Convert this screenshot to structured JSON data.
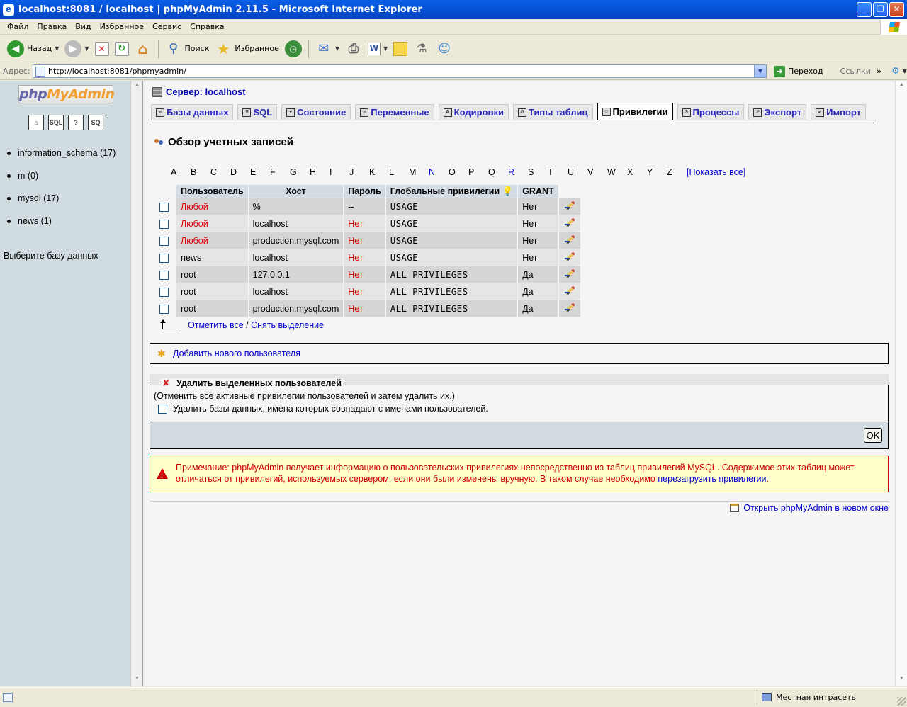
{
  "window": {
    "title": "localhost:8081 / localhost | phpMyAdmin 2.11.5 - Microsoft Internet Explorer"
  },
  "menu": [
    "Файл",
    "Правка",
    "Вид",
    "Избранное",
    "Сервис",
    "Справка"
  ],
  "toolbar": {
    "back": "Назад",
    "search": "Поиск",
    "favorites": "Избранное"
  },
  "address": {
    "label": "Адрес:",
    "url": "http://localhost:8081/phpmyadmin/",
    "go": "Переход",
    "links": "Ссылки"
  },
  "left": {
    "logo_php": "php",
    "logo_my": "MyAdmin",
    "databases": [
      "information_schema (17)",
      "m (0)",
      "mysql (17)",
      "news (1)"
    ],
    "choose": "Выберите базу данных"
  },
  "main": {
    "server": "Сервер: localhost",
    "tabs": [
      "Базы данных",
      "SQL",
      "Состояние",
      "Переменные",
      "Кодировки",
      "Типы таблиц",
      "Привилегии",
      "Процессы",
      "Экспорт",
      "Импорт"
    ],
    "active_tab": "Привилегии",
    "heading": "Обзор учетных записей",
    "alphabet": [
      "A",
      "B",
      "C",
      "D",
      "E",
      "F",
      "G",
      "H",
      "I",
      "J",
      "K",
      "L",
      "M",
      "N",
      "O",
      "P",
      "Q",
      "R",
      "S",
      "T",
      "U",
      "V",
      "W",
      "X",
      "Y",
      "Z"
    ],
    "alphabet_links": [
      "N",
      "R"
    ],
    "show_all": "[Показать все]",
    "table": {
      "headers": [
        "Пользователь",
        "Хост",
        "Пароль",
        "Глобальные привилегии",
        "GRANT"
      ],
      "rows": [
        {
          "user": "Любой",
          "host": "%",
          "password": "--",
          "privs": "USAGE",
          "grant": "Нет"
        },
        {
          "user": "Любой",
          "host": "localhost",
          "password": "Нет",
          "privs": "USAGE",
          "grant": "Нет"
        },
        {
          "user": "Любой",
          "host": "production.mysql.com",
          "password": "Нет",
          "privs": "USAGE",
          "grant": "Нет"
        },
        {
          "user": "news",
          "host": "localhost",
          "password": "Нет",
          "privs": "USAGE",
          "grant": "Нет"
        },
        {
          "user": "root",
          "host": "127.0.0.1",
          "password": "Нет",
          "privs": "ALL PRIVILEGES",
          "grant": "Да"
        },
        {
          "user": "root",
          "host": "localhost",
          "password": "Нет",
          "privs": "ALL PRIVILEGES",
          "grant": "Да"
        },
        {
          "user": "root",
          "host": "production.mysql.com",
          "password": "Нет",
          "privs": "ALL PRIVILEGES",
          "grant": "Да"
        }
      ]
    },
    "select_all": "Отметить все",
    "select_sep": " / ",
    "unselect": "Снять выделение",
    "add_user": "Добавить нового пользователя",
    "delete": {
      "legend": "Удалить выделенных пользователей",
      "note": "(Отменить все активные привилегии пользователей и затем удалить их.)",
      "drop_db": "Удалить базы данных, имена которых совпадают с именами пользователей.",
      "ok": "OK"
    },
    "notice": {
      "text": "Примечание: phpMyAdmin получает информацию о пользовательских привилегиях непосредственно из таблиц привилегий MySQL. Содержимое этих таблиц может отличаться от привилегий, используемых сервером, если они были изменены вручную. В таком случае необходимо ",
      "link": "перезагрузить привилегии",
      "end": "."
    },
    "open_new_window": "Открыть phpMyAdmin в новом окне"
  },
  "status": {
    "zone": "Местная интрасеть"
  }
}
